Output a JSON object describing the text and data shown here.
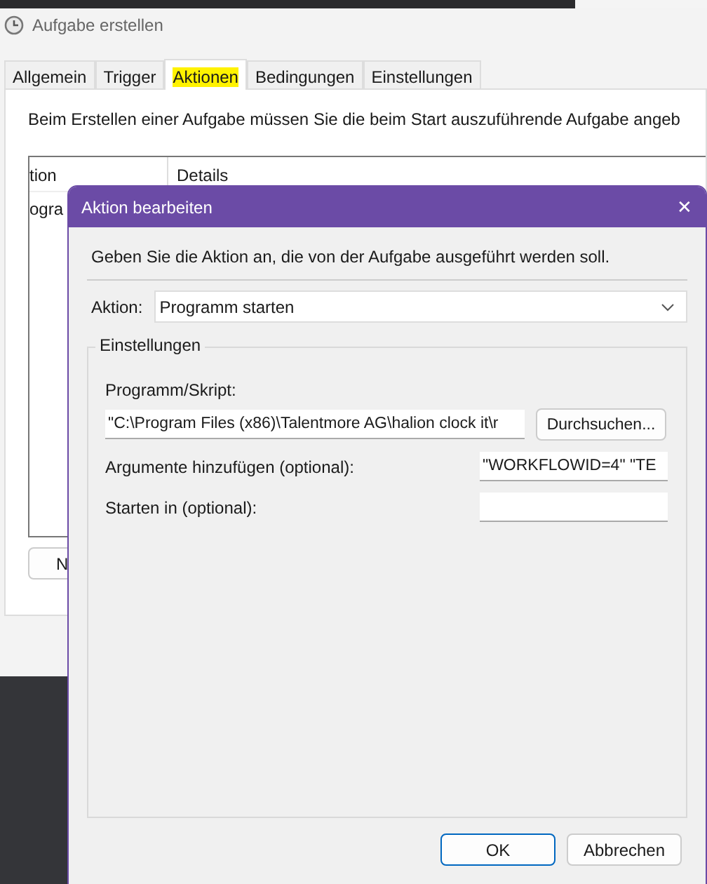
{
  "window": {
    "title": "Aufgabe erstellen"
  },
  "tabs": [
    {
      "label": "Allgemein",
      "selected": false,
      "highlighted": false
    },
    {
      "label": "Trigger",
      "selected": false,
      "highlighted": false
    },
    {
      "label": "Aktionen",
      "selected": true,
      "highlighted": true
    },
    {
      "label": "Bedingungen",
      "selected": false,
      "highlighted": false
    },
    {
      "label": "Einstellungen",
      "selected": false,
      "highlighted": false
    }
  ],
  "description": "Beim Erstellen einer Aufgabe müssen Sie die beim Start auszuführende Aufgabe angeb",
  "table": {
    "columns": [
      "tion",
      "Details"
    ],
    "rows": [
      [
        "ogra"
      ]
    ]
  },
  "new_button": "N",
  "dialog": {
    "title": "Aktion bearbeiten",
    "close": "✕",
    "instruction": "Geben Sie die Aktion an, die von der Aufgabe ausgeführt werden soll.",
    "action": {
      "label": "Aktion:",
      "value": "Programm starten"
    },
    "group": {
      "title": "Einstellungen",
      "program": {
        "label": "Programm/Skript:",
        "value": "\"C:\\Program Files (x86)\\Talentmore AG\\halion clock it\\r",
        "browse": "Durchsuchen..."
      },
      "arguments": {
        "label": "Argumente hinzufügen (optional):",
        "value": "\"WORKFLOWID=4\" \"TE"
      },
      "start_in": {
        "label": "Starten in (optional):"
      }
    },
    "buttons": [
      {
        "label": "OK",
        "default": true
      },
      {
        "label": "Abbrechen",
        "default": false
      }
    ]
  }
}
